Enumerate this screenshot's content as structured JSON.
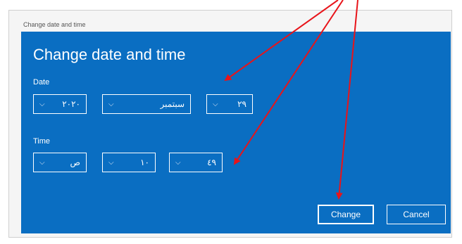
{
  "window": {
    "title": "Change date and time"
  },
  "panel": {
    "heading": "Change date and time"
  },
  "date": {
    "label": "Date",
    "year": "٢٠٢٠",
    "month": "سبتمبر",
    "day": "٢٩"
  },
  "time": {
    "label": "Time",
    "period": "ص",
    "hour": "١٠",
    "minute": "٤٩"
  },
  "buttons": {
    "change": "Change",
    "cancel": "Cancel"
  },
  "icons": {
    "dropdown": "chevron-down-icon"
  },
  "colors": {
    "panel": "#0a6ec2",
    "annotation_arrow": "#e8141a"
  }
}
